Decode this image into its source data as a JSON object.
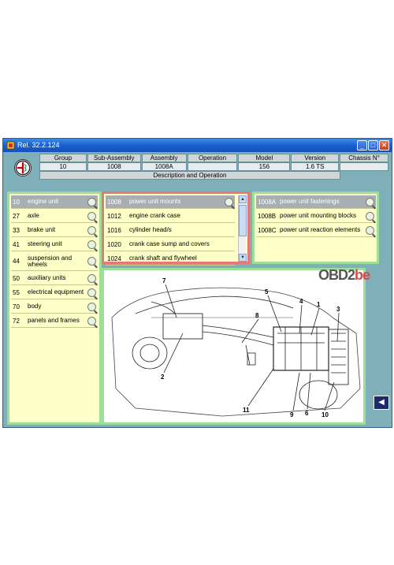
{
  "window": {
    "title": "Rel. 32.2.124",
    "controls": {
      "minimize": "_",
      "maximize": "□",
      "close": "✕"
    }
  },
  "header": {
    "labels": [
      "Group",
      "Sub-Assembly",
      "Assembly",
      "Operation",
      "Model",
      "Version",
      "Chassis N°"
    ],
    "values": [
      "10",
      "1008",
      "1008A",
      "",
      "156",
      "1.6 TS",
      ""
    ],
    "description_label": "Description and Operation"
  },
  "groups": [
    {
      "code": "10",
      "name": "engine unit",
      "selected": true
    },
    {
      "code": "27",
      "name": "axle"
    },
    {
      "code": "33",
      "name": "brake unit"
    },
    {
      "code": "41",
      "name": "steering unit"
    },
    {
      "code": "44",
      "name": "suspension and wheels"
    },
    {
      "code": "50",
      "name": "auxiliary units"
    },
    {
      "code": "55",
      "name": "electrical equipment"
    },
    {
      "code": "70",
      "name": "body"
    },
    {
      "code": "72",
      "name": "panels and frames"
    }
  ],
  "subassemblies": [
    {
      "code": "1008",
      "name": "power unit mounts",
      "selected": true
    },
    {
      "code": "1012",
      "name": "engine crank case"
    },
    {
      "code": "1016",
      "name": "cylinder head/s"
    },
    {
      "code": "1020",
      "name": "crank case sump and covers"
    },
    {
      "code": "1024",
      "name": "crank shaft and flywheel"
    }
  ],
  "assemblies": [
    {
      "code": "1008A",
      "name": "power unit fastenings",
      "selected": true
    },
    {
      "code": "1008B",
      "name": "power unit mounting blocks"
    },
    {
      "code": "1008C",
      "name": "power unit reaction elements"
    }
  ],
  "diagram": {
    "callouts": [
      "7",
      "5",
      "4",
      "1",
      "3",
      "8",
      "2",
      "11",
      "9",
      "6",
      "10"
    ]
  },
  "nav": {
    "back": "◀"
  },
  "brand": {
    "prefix": "OBD2",
    "suffix": "be"
  }
}
